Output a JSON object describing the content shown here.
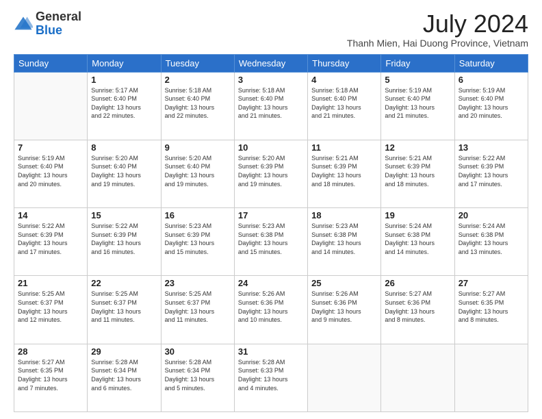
{
  "header": {
    "logo": {
      "line1": "General",
      "line2": "Blue"
    },
    "title": "July 2024",
    "subtitle": "Thanh Mien, Hai Duong Province, Vietnam"
  },
  "days_of_week": [
    "Sunday",
    "Monday",
    "Tuesday",
    "Wednesday",
    "Thursday",
    "Friday",
    "Saturday"
  ],
  "weeks": [
    [
      {
        "day": "",
        "info": ""
      },
      {
        "day": "1",
        "info": "Sunrise: 5:17 AM\nSunset: 6:40 PM\nDaylight: 13 hours\nand 22 minutes."
      },
      {
        "day": "2",
        "info": "Sunrise: 5:18 AM\nSunset: 6:40 PM\nDaylight: 13 hours\nand 22 minutes."
      },
      {
        "day": "3",
        "info": "Sunrise: 5:18 AM\nSunset: 6:40 PM\nDaylight: 13 hours\nand 21 minutes."
      },
      {
        "day": "4",
        "info": "Sunrise: 5:18 AM\nSunset: 6:40 PM\nDaylight: 13 hours\nand 21 minutes."
      },
      {
        "day": "5",
        "info": "Sunrise: 5:19 AM\nSunset: 6:40 PM\nDaylight: 13 hours\nand 21 minutes."
      },
      {
        "day": "6",
        "info": "Sunrise: 5:19 AM\nSunset: 6:40 PM\nDaylight: 13 hours\nand 20 minutes."
      }
    ],
    [
      {
        "day": "7",
        "info": "Sunrise: 5:19 AM\nSunset: 6:40 PM\nDaylight: 13 hours\nand 20 minutes."
      },
      {
        "day": "8",
        "info": "Sunrise: 5:20 AM\nSunset: 6:40 PM\nDaylight: 13 hours\nand 19 minutes."
      },
      {
        "day": "9",
        "info": "Sunrise: 5:20 AM\nSunset: 6:40 PM\nDaylight: 13 hours\nand 19 minutes."
      },
      {
        "day": "10",
        "info": "Sunrise: 5:20 AM\nSunset: 6:39 PM\nDaylight: 13 hours\nand 19 minutes."
      },
      {
        "day": "11",
        "info": "Sunrise: 5:21 AM\nSunset: 6:39 PM\nDaylight: 13 hours\nand 18 minutes."
      },
      {
        "day": "12",
        "info": "Sunrise: 5:21 AM\nSunset: 6:39 PM\nDaylight: 13 hours\nand 18 minutes."
      },
      {
        "day": "13",
        "info": "Sunrise: 5:22 AM\nSunset: 6:39 PM\nDaylight: 13 hours\nand 17 minutes."
      }
    ],
    [
      {
        "day": "14",
        "info": "Sunrise: 5:22 AM\nSunset: 6:39 PM\nDaylight: 13 hours\nand 17 minutes."
      },
      {
        "day": "15",
        "info": "Sunrise: 5:22 AM\nSunset: 6:39 PM\nDaylight: 13 hours\nand 16 minutes."
      },
      {
        "day": "16",
        "info": "Sunrise: 5:23 AM\nSunset: 6:39 PM\nDaylight: 13 hours\nand 15 minutes."
      },
      {
        "day": "17",
        "info": "Sunrise: 5:23 AM\nSunset: 6:38 PM\nDaylight: 13 hours\nand 15 minutes."
      },
      {
        "day": "18",
        "info": "Sunrise: 5:23 AM\nSunset: 6:38 PM\nDaylight: 13 hours\nand 14 minutes."
      },
      {
        "day": "19",
        "info": "Sunrise: 5:24 AM\nSunset: 6:38 PM\nDaylight: 13 hours\nand 14 minutes."
      },
      {
        "day": "20",
        "info": "Sunrise: 5:24 AM\nSunset: 6:38 PM\nDaylight: 13 hours\nand 13 minutes."
      }
    ],
    [
      {
        "day": "21",
        "info": "Sunrise: 5:25 AM\nSunset: 6:37 PM\nDaylight: 13 hours\nand 12 minutes."
      },
      {
        "day": "22",
        "info": "Sunrise: 5:25 AM\nSunset: 6:37 PM\nDaylight: 13 hours\nand 11 minutes."
      },
      {
        "day": "23",
        "info": "Sunrise: 5:25 AM\nSunset: 6:37 PM\nDaylight: 13 hours\nand 11 minutes."
      },
      {
        "day": "24",
        "info": "Sunrise: 5:26 AM\nSunset: 6:36 PM\nDaylight: 13 hours\nand 10 minutes."
      },
      {
        "day": "25",
        "info": "Sunrise: 5:26 AM\nSunset: 6:36 PM\nDaylight: 13 hours\nand 9 minutes."
      },
      {
        "day": "26",
        "info": "Sunrise: 5:27 AM\nSunset: 6:36 PM\nDaylight: 13 hours\nand 8 minutes."
      },
      {
        "day": "27",
        "info": "Sunrise: 5:27 AM\nSunset: 6:35 PM\nDaylight: 13 hours\nand 8 minutes."
      }
    ],
    [
      {
        "day": "28",
        "info": "Sunrise: 5:27 AM\nSunset: 6:35 PM\nDaylight: 13 hours\nand 7 minutes."
      },
      {
        "day": "29",
        "info": "Sunrise: 5:28 AM\nSunset: 6:34 PM\nDaylight: 13 hours\nand 6 minutes."
      },
      {
        "day": "30",
        "info": "Sunrise: 5:28 AM\nSunset: 6:34 PM\nDaylight: 13 hours\nand 5 minutes."
      },
      {
        "day": "31",
        "info": "Sunrise: 5:28 AM\nSunset: 6:33 PM\nDaylight: 13 hours\nand 4 minutes."
      },
      {
        "day": "",
        "info": ""
      },
      {
        "day": "",
        "info": ""
      },
      {
        "day": "",
        "info": ""
      }
    ]
  ]
}
